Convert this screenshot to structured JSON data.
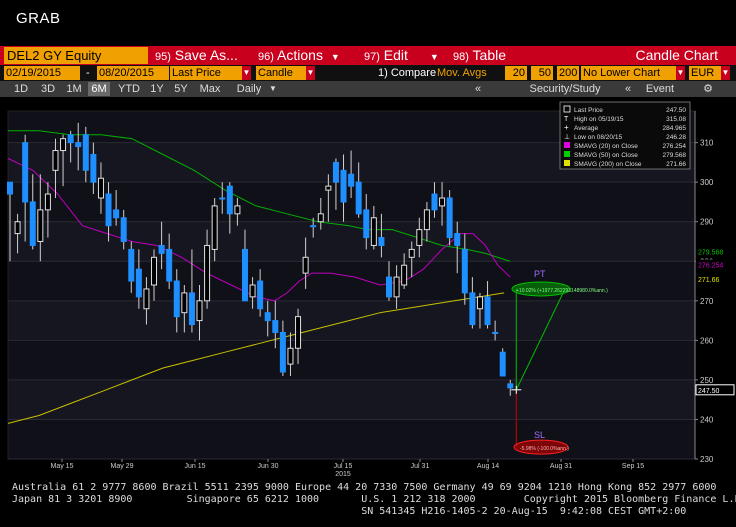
{
  "window": {
    "title": "GRAB"
  },
  "menu": {
    "ticker": "DEL2 GY Equity",
    "items": [
      {
        "num": "95)",
        "label": "Save As..."
      },
      {
        "num": "96)",
        "label": "Actions"
      },
      {
        "num": "97)",
        "label": "Edit"
      },
      {
        "num": "98)",
        "label": "Table"
      }
    ],
    "chart_title": "Candle Chart"
  },
  "params": {
    "start_date": "02/19/2015",
    "sep": "-",
    "end_date": "08/20/2015",
    "price_type": "Last Price",
    "chart_type": "Candle",
    "compare_label": "1) Compare",
    "compare_value": "Mov. Avgs",
    "ma1": "20",
    "ma2": "50",
    "ma3": "200",
    "lower_chart": "No Lower Chart",
    "currency": "EUR"
  },
  "periods": {
    "items": [
      "1D",
      "3D",
      "1M",
      "6M",
      "YTD",
      "1Y",
      "5Y",
      "Max"
    ],
    "active": "6M",
    "frequency": "Daily",
    "collapse_icon": "«",
    "security_study": "Security/Study",
    "collapse_icon2": "«",
    "event": "Event"
  },
  "chart_data": {
    "type": "candlestick",
    "ylim": [
      230,
      318
    ],
    "yticks": [
      230,
      240,
      250,
      260,
      270,
      280,
      290,
      300,
      310
    ],
    "xticks": [
      "May 15",
      "May 29",
      "Jun 15",
      "Jun 30",
      "Jul 15",
      "Jul 31",
      "Aug 14",
      "Aug 31",
      "Sep 15"
    ],
    "year_label": "2015",
    "last_price_label": "247.50",
    "axis_markers": [
      {
        "value": "279.568",
        "color": "#00c800"
      },
      {
        "value": "276.254",
        "color": "#d000d0"
      },
      {
        "value": "271.66",
        "color": "#e0e000"
      },
      {
        "value": "247.50",
        "color": "#ffffff"
      }
    ],
    "legend": [
      {
        "symbol": "box",
        "color": "#ffffff",
        "label": "Last Price",
        "value": "247.50"
      },
      {
        "symbol": "T",
        "color": "#ffffff",
        "label": "High on 05/19/15",
        "value": "315.08"
      },
      {
        "symbol": "plus",
        "color": "#ffffff",
        "label": "Average",
        "value": "284.965"
      },
      {
        "symbol": "perp",
        "color": "#ffffff",
        "label": "Low on 08/20/15",
        "value": "246.28"
      },
      {
        "symbol": "sq",
        "color": "#e000e0",
        "label": "SMAVG (20) on Close",
        "value": "276.254"
      },
      {
        "symbol": "sq",
        "color": "#00d000",
        "label": "SMAVG (50) on Close",
        "value": "279.568"
      },
      {
        "symbol": "sq",
        "color": "#e0e000",
        "label": "SMAVG (200) on Close",
        "value": "271.66"
      }
    ],
    "pt_label": "PT",
    "pt_text": "+10.02% (+1977.262293148980.0%ann.)",
    "sl_label": "SL",
    "sl_text": "-5.98% (-100.0%ann.)",
    "candles": [
      {
        "o": 297,
        "h": 300,
        "l": 280,
        "c": 300,
        "up": false
      },
      {
        "o": 287,
        "h": 292,
        "l": 282,
        "c": 290,
        "up": true
      },
      {
        "o": 310,
        "h": 312,
        "l": 285,
        "c": 295,
        "up": false
      },
      {
        "o": 295,
        "h": 302,
        "l": 283,
        "c": 284,
        "up": false
      },
      {
        "o": 285,
        "h": 302,
        "l": 280,
        "c": 293,
        "up": true
      },
      {
        "o": 297,
        "h": 300,
        "l": 286,
        "c": 293,
        "up": true
      },
      {
        "o": 303,
        "h": 311,
        "l": 296,
        "c": 308,
        "up": true
      },
      {
        "o": 308,
        "h": 312,
        "l": 299,
        "c": 311,
        "up": true
      },
      {
        "o": 312,
        "h": 313,
        "l": 305,
        "c": 310,
        "up": false
      },
      {
        "o": 310,
        "h": 315,
        "l": 303,
        "c": 309,
        "up": false
      },
      {
        "o": 312,
        "h": 314,
        "l": 300,
        "c": 303,
        "up": false
      },
      {
        "o": 307,
        "h": 310,
        "l": 297,
        "c": 300,
        "up": false
      },
      {
        "o": 301,
        "h": 305,
        "l": 292,
        "c": 296,
        "up": true
      },
      {
        "o": 297,
        "h": 300,
        "l": 285,
        "c": 289,
        "up": false
      },
      {
        "o": 293,
        "h": 298,
        "l": 289,
        "c": 291,
        "up": false
      },
      {
        "o": 291,
        "h": 293,
        "l": 283,
        "c": 285,
        "up": false
      },
      {
        "o": 283,
        "h": 285,
        "l": 272,
        "c": 275,
        "up": false
      },
      {
        "o": 278,
        "h": 283,
        "l": 268,
        "c": 271,
        "up": false
      },
      {
        "o": 268,
        "h": 276,
        "l": 264,
        "c": 273,
        "up": true
      },
      {
        "o": 274,
        "h": 283,
        "l": 270,
        "c": 281,
        "up": true
      },
      {
        "o": 282,
        "h": 290,
        "l": 278,
        "c": 284,
        "up": false
      },
      {
        "o": 283,
        "h": 287,
        "l": 273,
        "c": 275,
        "up": false
      },
      {
        "o": 275,
        "h": 278,
        "l": 262,
        "c": 266,
        "up": false
      },
      {
        "o": 267,
        "h": 274,
        "l": 262,
        "c": 272,
        "up": true
      },
      {
        "o": 272,
        "h": 283,
        "l": 262,
        "c": 264,
        "up": false
      },
      {
        "o": 265,
        "h": 274,
        "l": 260,
        "c": 270,
        "up": true
      },
      {
        "o": 270,
        "h": 288,
        "l": 268,
        "c": 284,
        "up": true
      },
      {
        "o": 283,
        "h": 296,
        "l": 280,
        "c": 294,
        "up": true
      },
      {
        "o": 296,
        "h": 300,
        "l": 292,
        "c": 296,
        "up": false
      },
      {
        "o": 299,
        "h": 300,
        "l": 287,
        "c": 292,
        "up": false
      },
      {
        "o": 292,
        "h": 296,
        "l": 289,
        "c": 294,
        "up": true
      },
      {
        "o": 283,
        "h": 288,
        "l": 270,
        "c": 270,
        "up": false
      },
      {
        "o": 271,
        "h": 276,
        "l": 268,
        "c": 274,
        "up": true
      },
      {
        "o": 275,
        "h": 278,
        "l": 266,
        "c": 268,
        "up": false
      },
      {
        "o": 267,
        "h": 270,
        "l": 261,
        "c": 265,
        "up": false
      },
      {
        "o": 265,
        "h": 270,
        "l": 258,
        "c": 262,
        "up": false
      },
      {
        "o": 262,
        "h": 265,
        "l": 251,
        "c": 252,
        "up": false
      },
      {
        "o": 254,
        "h": 262,
        "l": 251,
        "c": 258,
        "up": true
      },
      {
        "o": 258,
        "h": 268,
        "l": 254,
        "c": 266,
        "up": true
      },
      {
        "o": 277,
        "h": 286,
        "l": 273,
        "c": 281,
        "up": true
      },
      {
        "o": 289,
        "h": 291,
        "l": 286,
        "c": 289,
        "up": false
      },
      {
        "o": 290,
        "h": 296,
        "l": 288,
        "c": 292,
        "up": true
      },
      {
        "o": 298,
        "h": 302,
        "l": 290,
        "c": 299,
        "up": true
      },
      {
        "o": 305,
        "h": 306,
        "l": 293,
        "c": 300,
        "up": false
      },
      {
        "o": 303,
        "h": 307,
        "l": 290,
        "c": 295,
        "up": false
      },
      {
        "o": 302,
        "h": 308,
        "l": 296,
        "c": 299,
        "up": false
      },
      {
        "o": 300,
        "h": 305,
        "l": 291,
        "c": 292,
        "up": false
      },
      {
        "o": 293,
        "h": 297,
        "l": 283,
        "c": 286,
        "up": false
      },
      {
        "o": 284,
        "h": 294,
        "l": 283,
        "c": 291,
        "up": true
      },
      {
        "o": 286,
        "h": 292,
        "l": 281,
        "c": 284,
        "up": false
      },
      {
        "o": 276,
        "h": 280,
        "l": 270,
        "c": 271,
        "up": false
      },
      {
        "o": 271,
        "h": 279,
        "l": 268,
        "c": 276,
        "up": true
      },
      {
        "o": 274,
        "h": 282,
        "l": 273,
        "c": 279,
        "up": true
      },
      {
        "o": 281,
        "h": 285,
        "l": 276,
        "c": 283,
        "up": true
      },
      {
        "o": 284,
        "h": 291,
        "l": 281,
        "c": 288,
        "up": true
      },
      {
        "o": 288,
        "h": 295,
        "l": 285,
        "c": 293,
        "up": true
      },
      {
        "o": 297,
        "h": 300,
        "l": 291,
        "c": 293,
        "up": false
      },
      {
        "o": 294,
        "h": 300,
        "l": 289,
        "c": 296,
        "up": true
      },
      {
        "o": 296,
        "h": 298,
        "l": 284,
        "c": 286,
        "up": false
      },
      {
        "o": 287,
        "h": 290,
        "l": 277,
        "c": 284,
        "up": false
      },
      {
        "o": 283,
        "h": 287,
        "l": 269,
        "c": 272,
        "up": false
      },
      {
        "o": 272,
        "h": 276,
        "l": 263,
        "c": 264,
        "up": false
      },
      {
        "o": 268,
        "h": 272,
        "l": 263,
        "c": 271,
        "up": true
      },
      {
        "o": 271,
        "h": 275,
        "l": 263,
        "c": 264,
        "up": false
      },
      {
        "o": 262,
        "h": 265,
        "l": 260,
        "c": 262,
        "up": false
      },
      {
        "o": 257,
        "h": 258,
        "l": 251,
        "c": 251,
        "up": false
      },
      {
        "o": 249,
        "h": 250,
        "l": 246,
        "c": 248,
        "up": false
      }
    ],
    "sma20": [
      [
        0,
        306
      ],
      [
        8,
        303
      ],
      [
        16,
        297
      ],
      [
        24,
        289
      ],
      [
        32,
        287
      ],
      [
        40,
        285
      ],
      [
        48,
        284
      ],
      [
        56,
        281
      ],
      [
        64,
        277
      ],
      [
        72,
        274
      ],
      [
        80,
        271
      ],
      [
        86,
        270
      ],
      [
        90,
        272
      ],
      [
        94,
        275
      ],
      [
        98,
        277
      ],
      [
        104,
        277
      ],
      [
        112,
        276
      ],
      [
        120,
        274
      ],
      [
        128,
        275
      ],
      [
        134,
        278
      ],
      [
        140,
        283
      ],
      [
        146,
        287
      ],
      [
        150,
        287
      ],
      [
        154,
        284
      ],
      [
        158,
        279
      ],
      [
        162,
        276
      ]
    ],
    "sma50": [
      [
        0,
        313
      ],
      [
        10,
        313
      ],
      [
        20,
        312
      ],
      [
        30,
        312
      ],
      [
        40,
        311
      ],
      [
        50,
        307
      ],
      [
        60,
        303
      ],
      [
        70,
        298
      ],
      [
        80,
        294
      ],
      [
        90,
        292
      ],
      [
        100,
        290
      ],
      [
        110,
        289
      ],
      [
        116,
        288
      ],
      [
        124,
        288
      ],
      [
        132,
        286
      ],
      [
        140,
        284
      ],
      [
        148,
        283
      ],
      [
        154,
        282
      ],
      [
        162,
        280
      ]
    ],
    "sma200": [
      [
        0,
        239
      ],
      [
        10,
        241
      ],
      [
        20,
        244
      ],
      [
        30,
        247
      ],
      [
        40,
        250
      ],
      [
        50,
        253
      ],
      [
        60,
        255
      ],
      [
        70,
        257
      ],
      [
        80,
        259
      ],
      [
        90,
        261
      ],
      [
        100,
        263
      ],
      [
        110,
        265
      ],
      [
        120,
        267
      ],
      [
        128,
        268
      ],
      [
        136,
        269
      ],
      [
        144,
        270
      ],
      [
        152,
        271
      ],
      [
        160,
        272
      ]
    ]
  },
  "footer": {
    "line1": "Australia 61 2 9777 8600 Brazil 5511 2395 9000 Europe 44 20 7330 7500 Germany 49 69 9204 1210 Hong Kong 852 2977 6000",
    "line2": "Japan 81 3 3201 8900         Singapore 65 6212 1000       U.S. 1 212 318 2000        Copyright 2015 Bloomberg Finance L.P.",
    "line3": "                                                          SN 541345 H216-1405-2 20-Aug-15  9:42:08 CEST GMT+2:00"
  }
}
